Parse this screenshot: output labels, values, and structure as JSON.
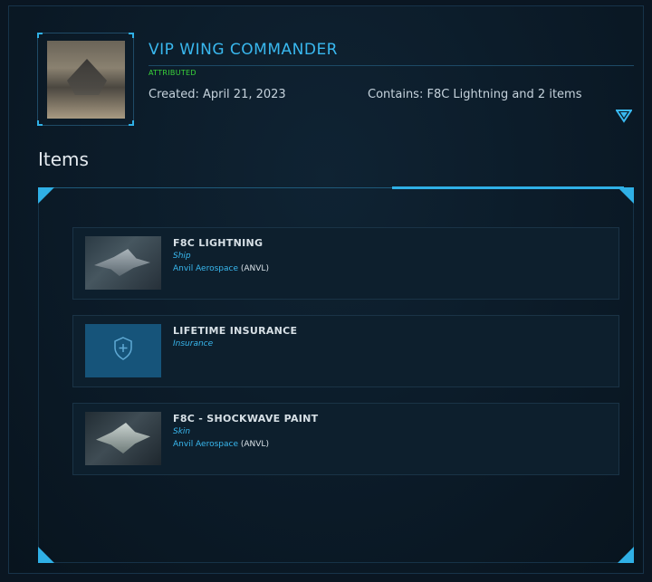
{
  "pledge": {
    "title": "VIP WING COMMANDER",
    "status": "ATTRIBUTED",
    "created": "Created: April 21, 2023",
    "contains": "Contains: F8C Lightning and 2 items"
  },
  "items_heading": "Items",
  "items": [
    {
      "name": "F8C LIGHTNING",
      "type": "Ship",
      "manufacturer": "Anvil Aerospace",
      "manufacturer_code": "(ANVL)",
      "thumbnail": "ship-image"
    },
    {
      "name": "LIFETIME INSURANCE",
      "type": "Insurance",
      "manufacturer": "",
      "manufacturer_code": "",
      "thumbnail": "shield-plus-icon"
    },
    {
      "name": "F8C - SHOCKWAVE PAINT",
      "type": "Skin",
      "manufacturer": "Anvil Aerospace",
      "manufacturer_code": "(ANVL)",
      "thumbnail": "ship-skin-image"
    }
  ],
  "colors": {
    "accent": "#39b8ef",
    "status_green": "#3ad43a",
    "background": "#0a1622"
  }
}
